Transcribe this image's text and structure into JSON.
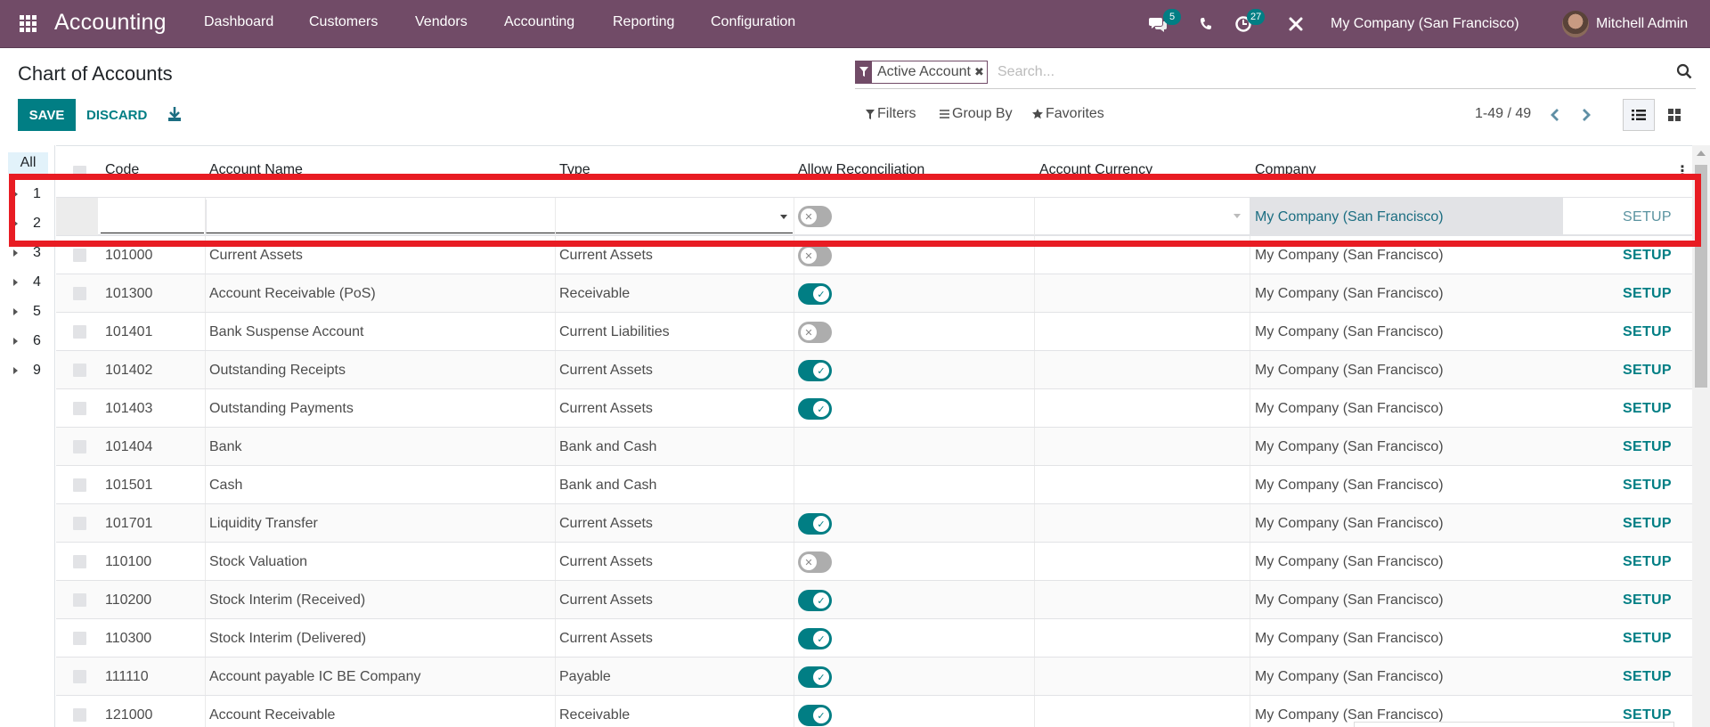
{
  "navbar": {
    "app_name": "Accounting",
    "menu": [
      "Dashboard",
      "Customers",
      "Vendors",
      "Accounting",
      "Reporting",
      "Configuration"
    ],
    "messages_count": "5",
    "activities_count": "27",
    "company": "My Company (San Francisco)",
    "user": "Mitchell Admin",
    "icons": [
      "apps-grid-icon",
      "chat-icon",
      "phone-icon",
      "activity-clock-icon",
      "debug-tools-icon"
    ]
  },
  "control_panel": {
    "title": "Chart of Accounts",
    "save_label": "SAVE",
    "discard_label": "DISCARD",
    "search_facet": "Active Account",
    "search_placeholder": "Search...",
    "filters_label": "Filters",
    "group_by_label": "Group By",
    "favorites_label": "Favorites",
    "pager": "1-49 / 49"
  },
  "side_panel": {
    "all_label": "All",
    "items": [
      "1",
      "2",
      "3",
      "4",
      "5",
      "6",
      "9"
    ]
  },
  "table": {
    "columns": [
      "Code",
      "Account Name",
      "Type",
      "Allow Reconciliation",
      "Account Currency",
      "Company"
    ],
    "setup_label": "SETUP",
    "edit_row": {
      "code": "",
      "name": "",
      "type": "",
      "allow_reconciliation": false,
      "currency": "",
      "company": "My Company (San Francisco)"
    },
    "rows": [
      {
        "code": "101000",
        "name": "Current Assets",
        "type": "Current Assets",
        "reconcile": "off",
        "currency": "",
        "company": "My Company (San Francisco)"
      },
      {
        "code": "101300",
        "name": "Account Receivable (PoS)",
        "type": "Receivable",
        "reconcile": "on",
        "currency": "",
        "company": "My Company (San Francisco)"
      },
      {
        "code": "101401",
        "name": "Bank Suspense Account",
        "type": "Current Liabilities",
        "reconcile": "off",
        "currency": "",
        "company": "My Company (San Francisco)"
      },
      {
        "code": "101402",
        "name": "Outstanding Receipts",
        "type": "Current Assets",
        "reconcile": "on",
        "currency": "",
        "company": "My Company (San Francisco)"
      },
      {
        "code": "101403",
        "name": "Outstanding Payments",
        "type": "Current Assets",
        "reconcile": "on",
        "currency": "",
        "company": "My Company (San Francisco)"
      },
      {
        "code": "101404",
        "name": "Bank",
        "type": "Bank and Cash",
        "reconcile": "none",
        "currency": "",
        "company": "My Company (San Francisco)"
      },
      {
        "code": "101501",
        "name": "Cash",
        "type": "Bank and Cash",
        "reconcile": "none",
        "currency": "",
        "company": "My Company (San Francisco)"
      },
      {
        "code": "101701",
        "name": "Liquidity Transfer",
        "type": "Current Assets",
        "reconcile": "on",
        "currency": "",
        "company": "My Company (San Francisco)"
      },
      {
        "code": "110100",
        "name": "Stock Valuation",
        "type": "Current Assets",
        "reconcile": "off",
        "currency": "",
        "company": "My Company (San Francisco)"
      },
      {
        "code": "110200",
        "name": "Stock Interim (Received)",
        "type": "Current Assets",
        "reconcile": "on",
        "currency": "",
        "company": "My Company (San Francisco)"
      },
      {
        "code": "110300",
        "name": "Stock Interim (Delivered)",
        "type": "Current Assets",
        "reconcile": "on",
        "currency": "",
        "company": "My Company (San Francisco)"
      },
      {
        "code": "111110",
        "name": "Account payable IC BE Company",
        "type": "Payable",
        "reconcile": "on",
        "currency": "",
        "company": "My Company (San Francisco)"
      },
      {
        "code": "121000",
        "name": "Account Receivable",
        "type": "Receivable",
        "reconcile": "on",
        "currency": "",
        "company": "My Company (San Francisco)"
      }
    ]
  },
  "colors": {
    "brand": "#714b67",
    "accent": "#017e84",
    "highlight": "#e81c23"
  }
}
